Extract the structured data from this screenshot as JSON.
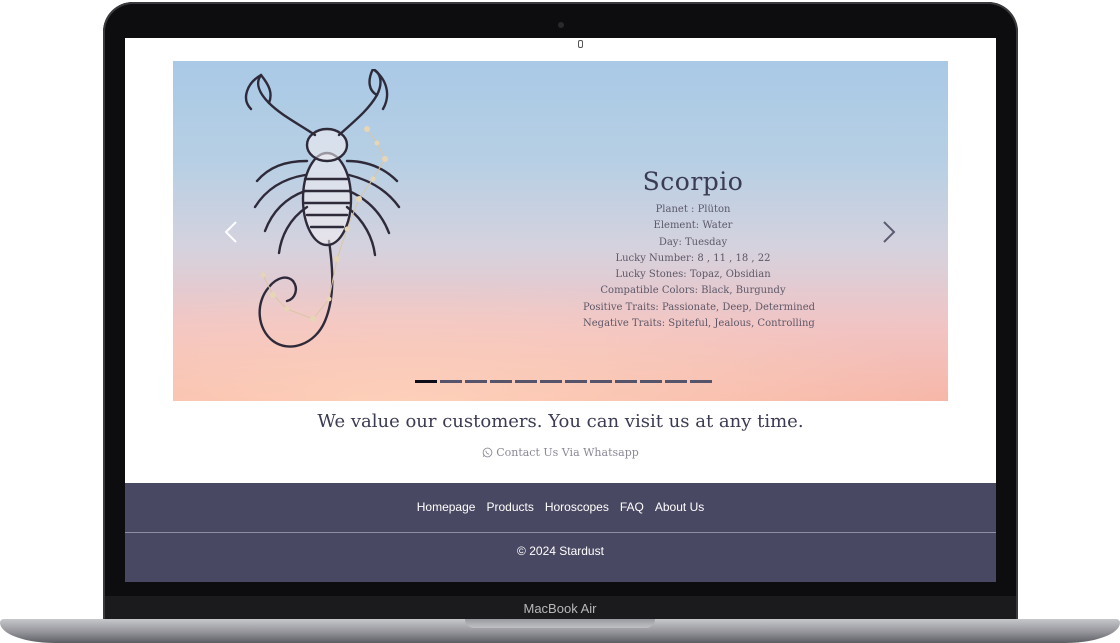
{
  "device": {
    "model_label": "MacBook Air"
  },
  "carousel": {
    "sign": {
      "name": "Scorpio",
      "lines": [
        "Planet : Plüton",
        "Element: Water",
        "Day: Tuesday",
        "Lucky Number: 8 , 11 , 18 , 22",
        "Lucky Stones: Topaz, Obsidian",
        "Compatible Colors: Black, Burgundy",
        "Positive Traits: Passionate, Deep, Determined",
        "Negative Traits: Spiteful, Jealous, Controlling"
      ]
    },
    "illustration": "scorpion-constellation",
    "slide_count": 12,
    "active_slide": 1,
    "prev_icon": "chevron-left-icon",
    "next_icon": "chevron-right-icon"
  },
  "tagline": "We value our customers. You can visit us at any time.",
  "contact": {
    "icon": "whatsapp-icon",
    "label": "Contact Us Via Whatsapp"
  },
  "footer": {
    "links": [
      "Homepage",
      "Products",
      "Horoscopes",
      "FAQ",
      "About Us"
    ],
    "copyright": "© 2024 Stardust"
  },
  "colors": {
    "footer_bg": "#494862",
    "heading": "#3b3b54",
    "text_muted": "#8a8a98"
  }
}
